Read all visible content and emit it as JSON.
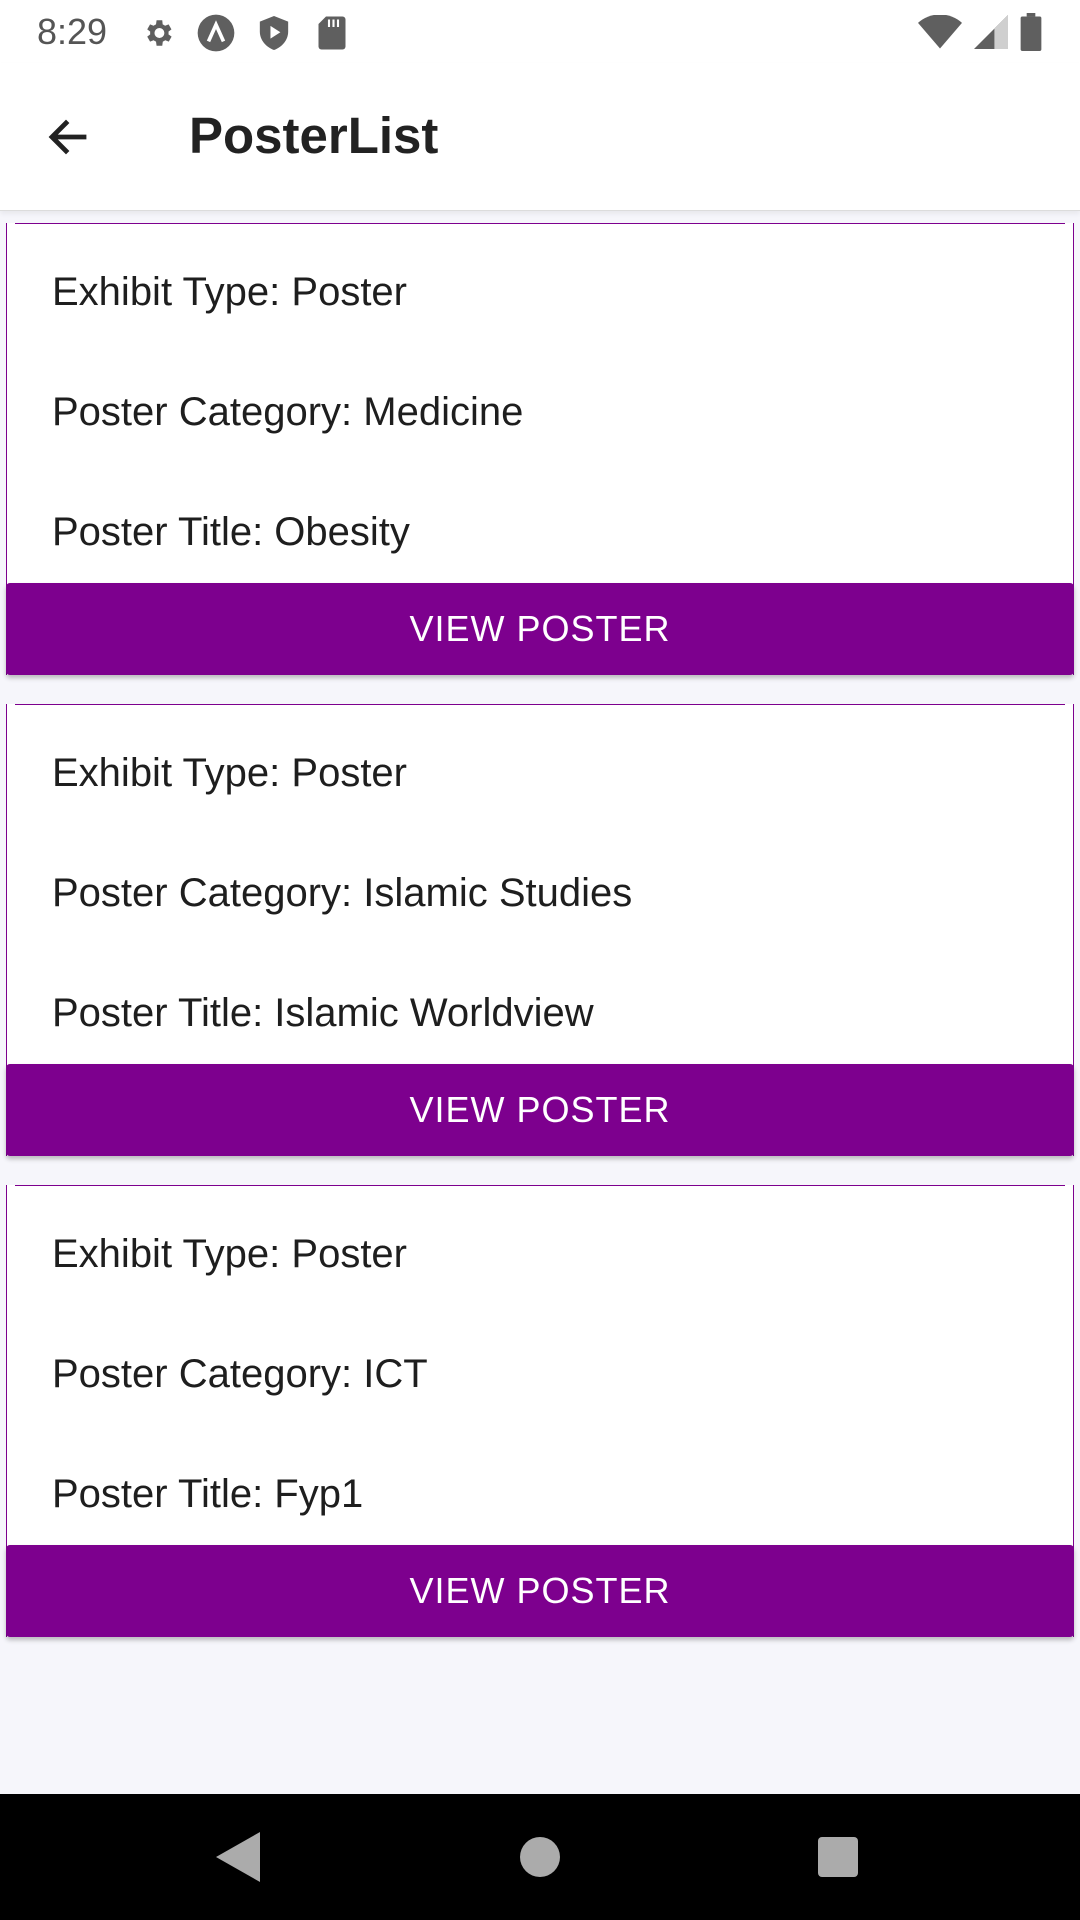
{
  "status_bar": {
    "time": "8:29",
    "icons_left": [
      "settings-gear-icon",
      "app-notification-icon",
      "play-shield-icon",
      "sd-card-icon"
    ],
    "icons_right": [
      "wifi-icon",
      "cellular-signal-icon",
      "battery-icon"
    ]
  },
  "app_bar": {
    "back_icon": "arrow-left-icon",
    "title": "PosterList"
  },
  "posters": [
    {
      "exhibit_type": "Exhibit Type: Poster",
      "category": "Poster Category: Medicine",
      "title": "Poster Title: Obesity",
      "button_label": "VIEW POSTER"
    },
    {
      "exhibit_type": "Exhibit Type: Poster",
      "category": "Poster Category: Islamic Studies",
      "title": "Poster Title: Islamic Worldview",
      "button_label": "VIEW POSTER"
    },
    {
      "exhibit_type": "Exhibit Type: Poster",
      "category": "Poster Category: ICT",
      "title": "Poster Title: Fyp1",
      "button_label": "VIEW POSTER"
    }
  ],
  "nav_bar": {
    "icons": [
      "back-triangle-icon",
      "home-circle-icon",
      "recents-square-icon"
    ]
  },
  "colors": {
    "accent": "#7d008e",
    "background": "#f6f6fb",
    "surface": "#ffffff",
    "nav_bar": "#000000"
  }
}
